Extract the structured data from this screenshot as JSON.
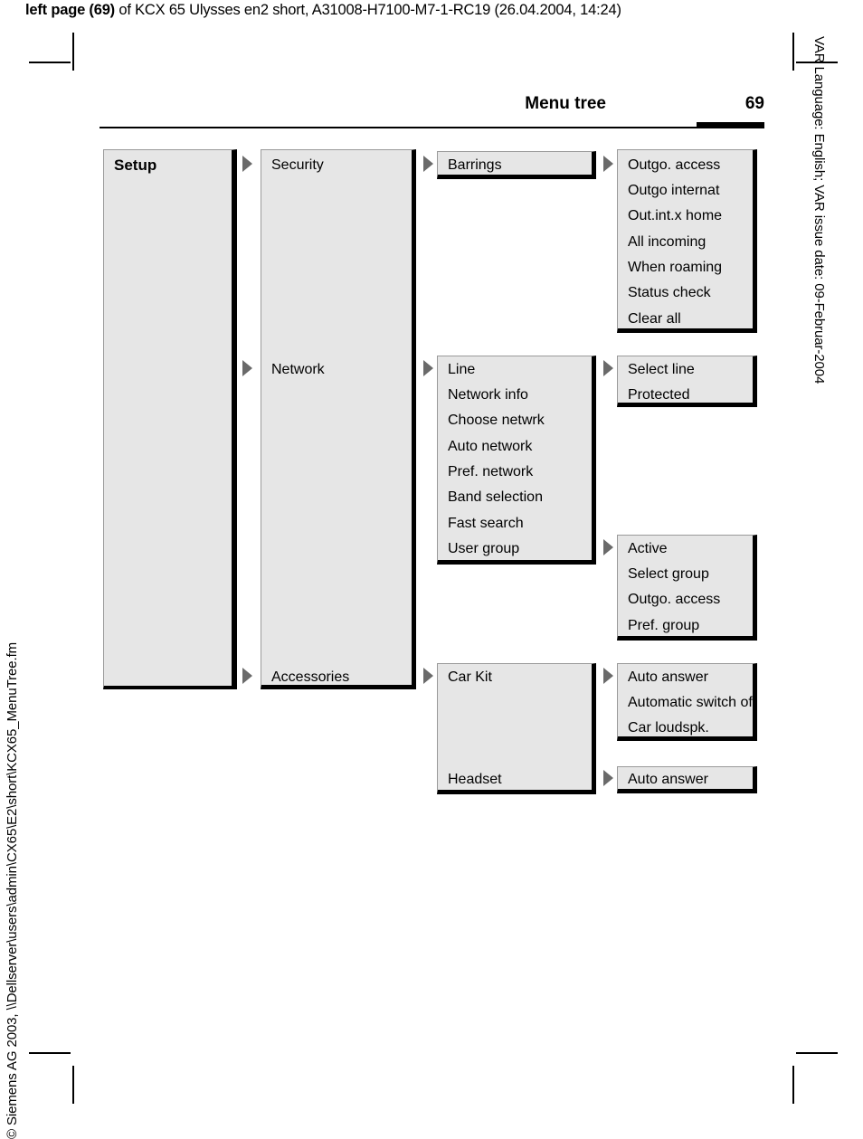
{
  "print_header": {
    "bold_part": "left page (69)",
    "rest_part": " of KCX 65 Ulysses en2 short, A31008-H7100-M7-1-RC19 (26.04.2004, 14:24)"
  },
  "side_notes": {
    "right": "VAR Language: English; VAR issue date: 09-Februar-2004",
    "left": "© Siemens AG 2003, \\\\Dellserver\\users\\admin\\CX65\\E2\\short\\KCX65_MenuTree.fm"
  },
  "running_head": {
    "title": "Menu tree",
    "page_number": "69"
  },
  "menu_tree": {
    "root": {
      "label": "Setup"
    },
    "level2": [
      {
        "label": "Security"
      },
      {
        "label": "Network"
      },
      {
        "label": "Accessories"
      }
    ],
    "security_children": {
      "items": [
        "Barrings"
      ]
    },
    "barrings_children": {
      "items": [
        "Outgo. access",
        "Outgo internat",
        "Out.int.x home",
        "All incoming",
        "When roaming",
        "Status check",
        "Clear all"
      ]
    },
    "network_children": {
      "items": [
        "Line",
        "Network info",
        "Choose netwrk",
        "Auto network",
        "Pref. network",
        "Band selection",
        "Fast search",
        "User group"
      ]
    },
    "line_children": {
      "items": [
        "Select line",
        "Protected"
      ]
    },
    "usergroup_children": {
      "items": [
        "Active",
        "Select group",
        "Outgo. access",
        "Pref. group"
      ]
    },
    "accessories_children": {
      "items": [
        "Car Kit",
        "Headset"
      ]
    },
    "carkit_children": {
      "items": [
        "Auto answer",
        "Automatic switch off",
        "Car loudspk."
      ]
    },
    "headset_children": {
      "items": [
        "Auto answer"
      ]
    }
  },
  "colors": {
    "box_fill": "#e6e6e6",
    "box_shadow": "#000000",
    "arrow": "#6a6a6a",
    "text": "#000000"
  }
}
